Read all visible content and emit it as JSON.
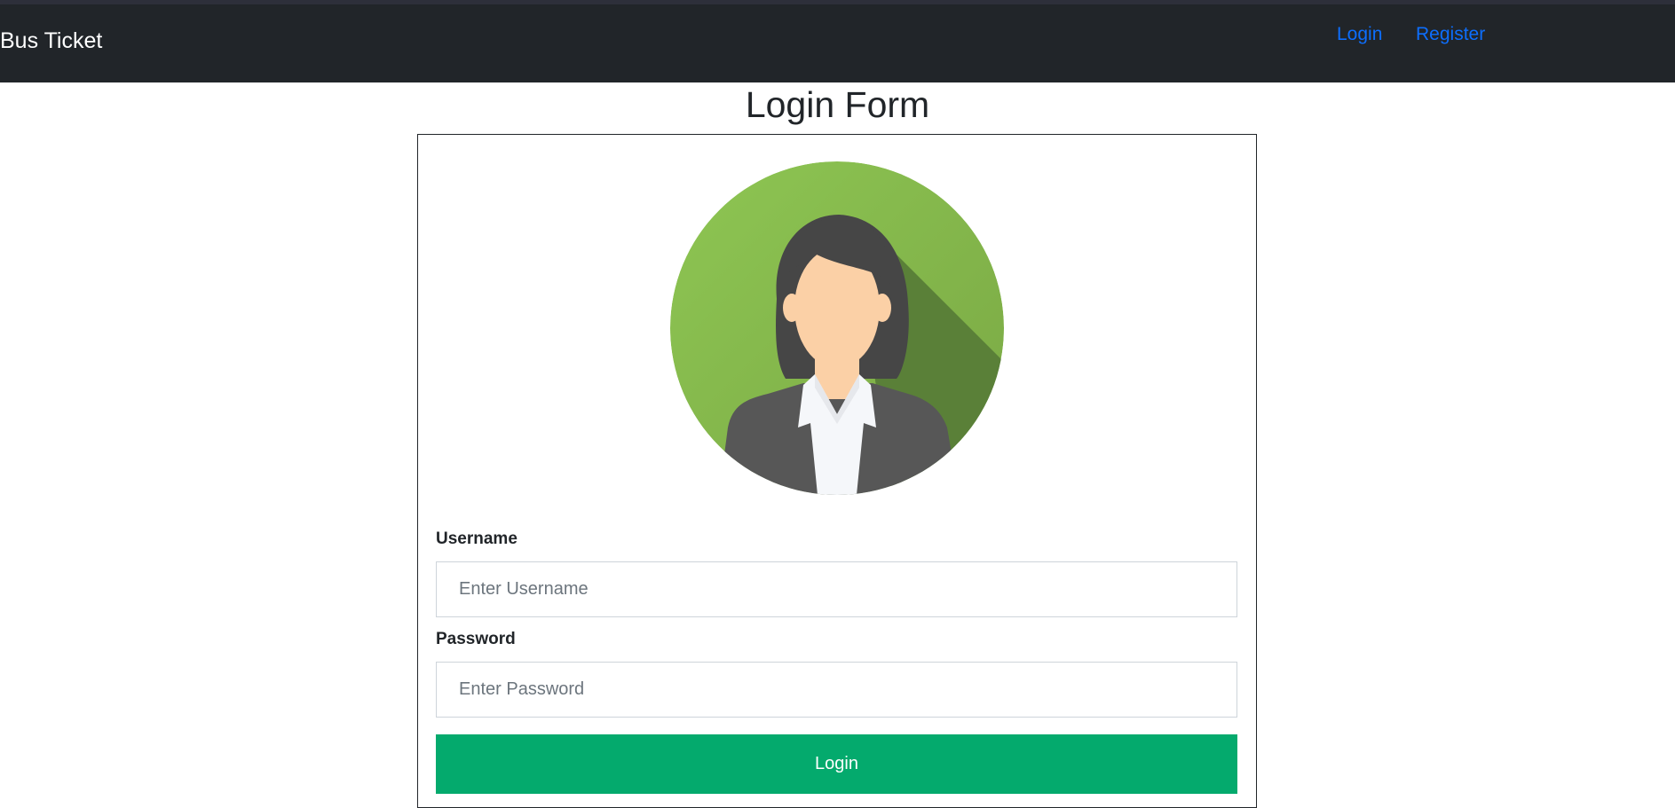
{
  "navbar": {
    "brand": "Bus Ticket",
    "links": [
      {
        "label": "Login"
      },
      {
        "label": "Register"
      }
    ]
  },
  "page": {
    "title": "Login Form"
  },
  "form": {
    "avatar_icon": "businesswoman-avatar-icon",
    "username": {
      "label": "Username",
      "placeholder": "Enter Username",
      "value": ""
    },
    "password": {
      "label": "Password",
      "placeholder": "Enter Password",
      "value": ""
    },
    "submit_label": "Login"
  },
  "colors": {
    "navbar_bg": "#212529",
    "nav_link": "#0d6efd",
    "button_bg": "#04aa6d",
    "avatar_green": "#8bc34a"
  }
}
